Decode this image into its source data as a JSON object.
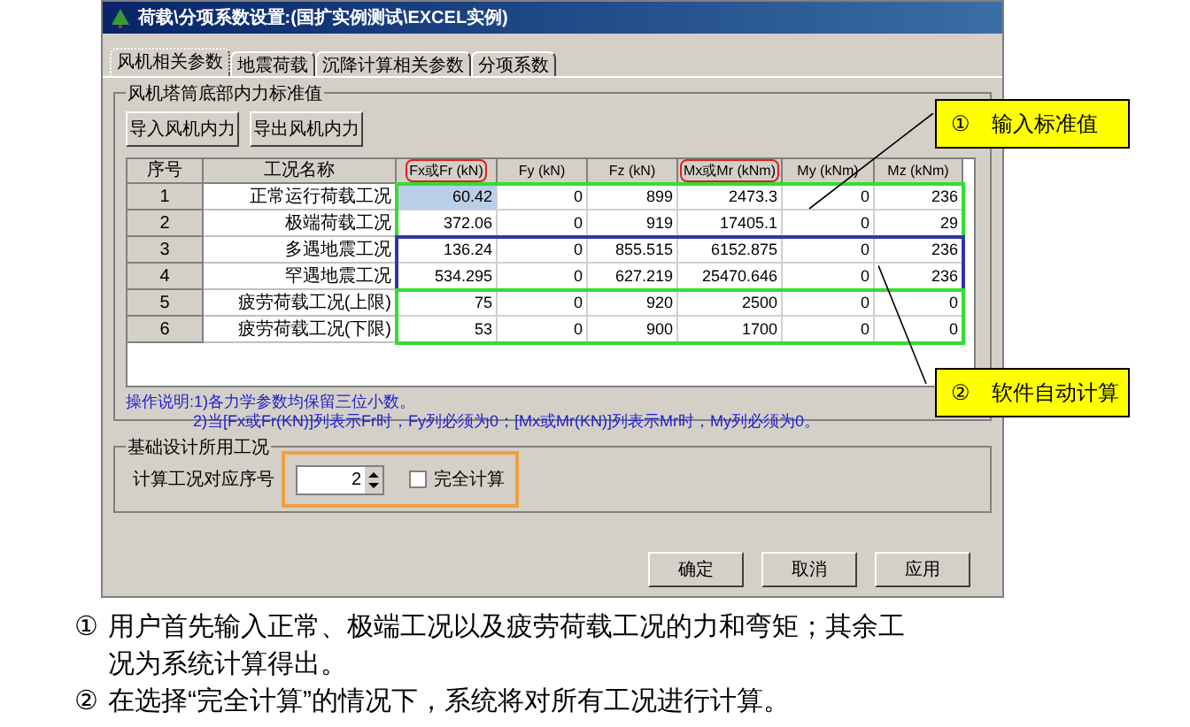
{
  "window": {
    "title": "荷载\\分项系数设置:(国扩实例测试\\EXCEL实例)"
  },
  "tabs": [
    {
      "label": "风机相关参数",
      "selected": true
    },
    {
      "label": "地震荷载",
      "selected": false
    },
    {
      "label": "沉降计算相关参数",
      "selected": false
    },
    {
      "label": "分项系数",
      "selected": false
    }
  ],
  "group": {
    "title": "风机塔筒底部内力标准值",
    "buttons": [
      "导入风机内力",
      "导出风机内力"
    ]
  },
  "table": {
    "index_column": "序号",
    "name_column": "工况名称",
    "columns": [
      {
        "label": "Fx或Fr (kN)",
        "highlighted": true
      },
      {
        "label": "Fy (kN)",
        "highlighted": false
      },
      {
        "label": "Fz (kN)",
        "highlighted": false
      },
      {
        "label": "Mx或Mr (kNm)",
        "highlighted": true
      },
      {
        "label": "My (kNm)",
        "highlighted": false
      },
      {
        "label": "Mz (kNm)",
        "highlighted": false
      }
    ],
    "row_groups": [
      {
        "color": "#33dd33",
        "rows": [
          {
            "index": "1",
            "name": "正常运行荷载工况",
            "cells": [
              {
                "text": "60.42",
                "selected": true
              },
              {
                "text": "0",
                "selected": false
              },
              {
                "text": "899",
                "selected": false
              },
              {
                "text": "2473.3",
                "selected": false
              },
              {
                "text": "0",
                "selected": false
              },
              {
                "text": "236",
                "selected": false
              }
            ]
          },
          {
            "index": "2",
            "name": "极端荷载工况",
            "cells": [
              {
                "text": "372.06",
                "selected": false
              },
              {
                "text": "0",
                "selected": false
              },
              {
                "text": "919",
                "selected": false
              },
              {
                "text": "17405.1",
                "selected": false
              },
              {
                "text": "0",
                "selected": false
              },
              {
                "text": "29",
                "selected": false
              }
            ]
          }
        ]
      },
      {
        "color": "#3333aa",
        "rows": [
          {
            "index": "3",
            "name": "多遇地震工况",
            "cells": [
              {
                "text": "136.24",
                "selected": false
              },
              {
                "text": "0",
                "selected": false
              },
              {
                "text": "855.515",
                "selected": false
              },
              {
                "text": "6152.875",
                "selected": false
              },
              {
                "text": "0",
                "selected": false
              },
              {
                "text": "236",
                "selected": false
              }
            ]
          },
          {
            "index": "4",
            "name": "罕遇地震工况",
            "cells": [
              {
                "text": "534.295",
                "selected": false
              },
              {
                "text": "0",
                "selected": false
              },
              {
                "text": "627.219",
                "selected": false
              },
              {
                "text": "25470.646",
                "selected": false
              },
              {
                "text": "0",
                "selected": false
              },
              {
                "text": "236",
                "selected": false
              }
            ]
          }
        ]
      },
      {
        "color": "#33dd33",
        "rows": [
          {
            "index": "5",
            "name": "疲劳荷载工况(上限)",
            "cells": [
              {
                "text": "75",
                "selected": false
              },
              {
                "text": "0",
                "selected": false
              },
              {
                "text": "920",
                "selected": false
              },
              {
                "text": "2500",
                "selected": false
              },
              {
                "text": "0",
                "selected": false
              },
              {
                "text": "0",
                "selected": false
              }
            ]
          },
          {
            "index": "6",
            "name": "疲劳荷载工况(下限)",
            "cells": [
              {
                "text": "53",
                "selected": false
              },
              {
                "text": "0",
                "selected": false
              },
              {
                "text": "900",
                "selected": false
              },
              {
                "text": "1700",
                "selected": false
              },
              {
                "text": "0",
                "selected": false
              },
              {
                "text": "0",
                "selected": false
              }
            ]
          }
        ]
      }
    ]
  },
  "notes": [
    "操作说明:1)各力学参数均保留三位小数。",
    "2)当[Fx或Fr(KN)]列表示Fr时，Fy列必须为0；[Mx或Mr(KN)]列表示Mr时，My列必须为0。"
  ],
  "design": {
    "title": "基础设计所用工况",
    "label": "计算工况对应序号",
    "value": "2",
    "checkbox": {
      "label": "完全计算",
      "checked": false
    }
  },
  "buttons": [
    "确定",
    "取消",
    "应用"
  ],
  "callouts": [
    {
      "marker": "①",
      "text": "输入标准值"
    },
    {
      "marker": "②",
      "text": "软件自动计算"
    }
  ],
  "footnotes": [
    {
      "marker": "①",
      "text": "用户首先输入正常、极端工况以及疲劳荷载工况的力和弯矩；其余工况为系统计算得出。"
    },
    {
      "marker": "②",
      "text": "在选择“完全计算”的情况下，系统将对所有工况进行计算。"
    }
  ]
}
